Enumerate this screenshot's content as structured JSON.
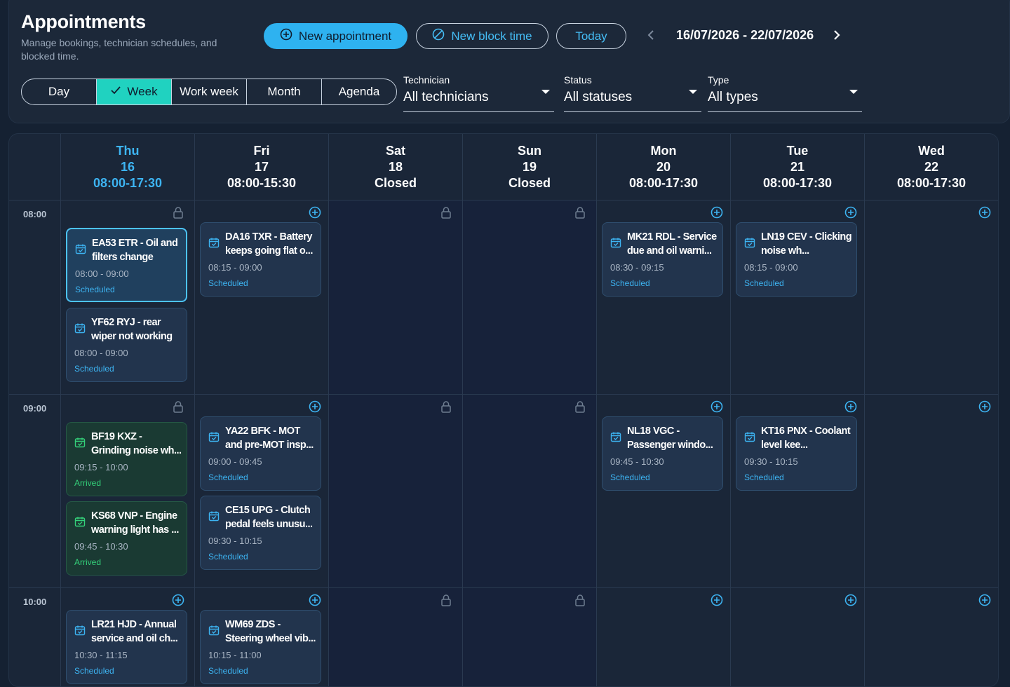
{
  "header": {
    "title": "Appointments",
    "subtitle": "Manage bookings, technician schedules, and blocked time.",
    "new_appointment": "New appointment",
    "new_block_time": "New block time",
    "today": "Today",
    "date_range": "16/07/2026 - 22/07/2026"
  },
  "views": [
    "Day",
    "Week",
    "Work week",
    "Month",
    "Agenda"
  ],
  "active_view": "Week",
  "filters": {
    "technician": {
      "label": "Technician",
      "value": "All technicians"
    },
    "status": {
      "label": "Status",
      "value": "All statuses"
    },
    "type": {
      "label": "Type",
      "value": "All types"
    }
  },
  "days": [
    {
      "name": "Thu",
      "date": "16",
      "hours": "08:00-17:30",
      "today": true
    },
    {
      "name": "Fri",
      "date": "17",
      "hours": "08:00-15:30"
    },
    {
      "name": "Sat",
      "date": "18",
      "hours": "Closed"
    },
    {
      "name": "Sun",
      "date": "19",
      "hours": "Closed"
    },
    {
      "name": "Mon",
      "date": "20",
      "hours": "08:00-17:30"
    },
    {
      "name": "Tue",
      "date": "21",
      "hours": "08:00-17:30"
    },
    {
      "name": "Wed",
      "date": "22",
      "hours": "08:00-17:30"
    }
  ],
  "times": [
    "08:00",
    "09:00",
    "10:00"
  ],
  "appointments": [
    {
      "title": "EA53 ETR - Oil and filters change",
      "time": "08:00 - 09:00",
      "status": "Scheduled"
    },
    {
      "title": "YF62 RYJ - rear wiper not working",
      "time": "08:00 - 09:00",
      "status": "Scheduled"
    },
    {
      "title": "DA16 TXR - Battery keeps going flat o...",
      "time": "08:15 - 09:00",
      "status": "Scheduled"
    },
    {
      "title": "MK21 RDL - Service due and oil warni...",
      "time": "08:30 - 09:15",
      "status": "Scheduled"
    },
    {
      "title": "LN19 CEV - Clicking noise wh...",
      "time": "08:15 - 09:00",
      "status": "Scheduled"
    },
    {
      "title": "BF19 KXZ - Grinding noise wh...",
      "time": "09:15 - 10:00",
      "status": "Arrived"
    },
    {
      "title": "KS68 VNP - Engine warning light has ...",
      "time": "09:45 - 10:30",
      "status": "Arrived"
    },
    {
      "title": "YA22 BFK - MOT and pre-MOT insp...",
      "time": "09:00 - 09:45",
      "status": "Scheduled"
    },
    {
      "title": "CE15 UPG - Clutch pedal feels unusu...",
      "time": "09:30 - 10:15",
      "status": "Scheduled"
    },
    {
      "title": "NL18 VGC - Passenger windo...",
      "time": "09:45 - 10:30",
      "status": "Scheduled"
    },
    {
      "title": "KT16 PNX - Coolant level kee...",
      "time": "09:30 - 10:15",
      "status": "Scheduled"
    },
    {
      "title": "LR21 HJD - Annual service and oil ch...",
      "time": "10:30 - 11:15",
      "status": "Scheduled"
    },
    {
      "title": "WM69 ZDS - Steering wheel vib...",
      "time": "10:15 - 11:00",
      "status": "Scheduled"
    }
  ],
  "icons": {
    "add_slot": "plus-circle-icon",
    "blocked_slot": "lock-icon",
    "appointment": "calendar-check-icon"
  },
  "colors": {
    "accent": "#2eb2f0",
    "active_view": "#20d2c0",
    "scheduled": "#3db4f2",
    "arrived": "#34d17a",
    "background": "#152132"
  }
}
